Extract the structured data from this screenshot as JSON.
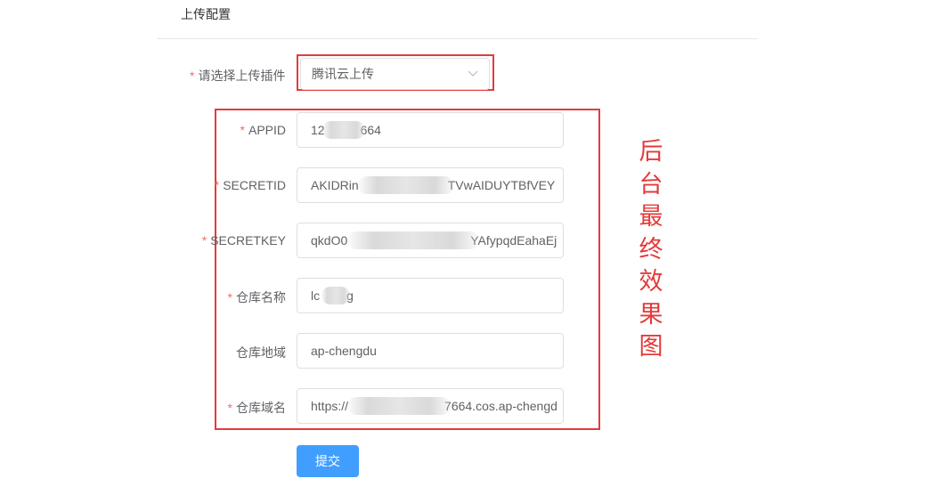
{
  "section_title": "上传配置",
  "plugin": {
    "required": "*",
    "label": "请选择上传插件",
    "selected": "腾讯云上传",
    "chevron_icon": "chevron-down-icon"
  },
  "fields": [
    {
      "required": "*",
      "label": "APPID",
      "prefix": "12",
      "suffix": "664"
    },
    {
      "required": "*",
      "label": "SECRETID",
      "prefix": "AKIDRin",
      "suffix": "TVwAIDUYTBfVEY"
    },
    {
      "required": "*",
      "label": "SECRETKEY",
      "prefix": "qkdO0",
      "suffix": "YAfypqdEahaEj"
    },
    {
      "required": "*",
      "label": "仓库名称",
      "prefix": "lc",
      "suffix": "g"
    },
    {
      "required": "",
      "label": "仓库地域",
      "prefix": "ap-chengdu",
      "suffix": ""
    },
    {
      "required": "*",
      "label": "仓库域名",
      "prefix": "https://",
      "suffix": "7664.cos.ap-chengd"
    }
  ],
  "submit_label": "提交",
  "annotation": [
    "后",
    "台",
    "最",
    "终",
    "效",
    "果",
    "图"
  ],
  "colors": {
    "accent": "#409eff",
    "annotation_red": "#e33b3b",
    "required": "#f56c6c"
  }
}
